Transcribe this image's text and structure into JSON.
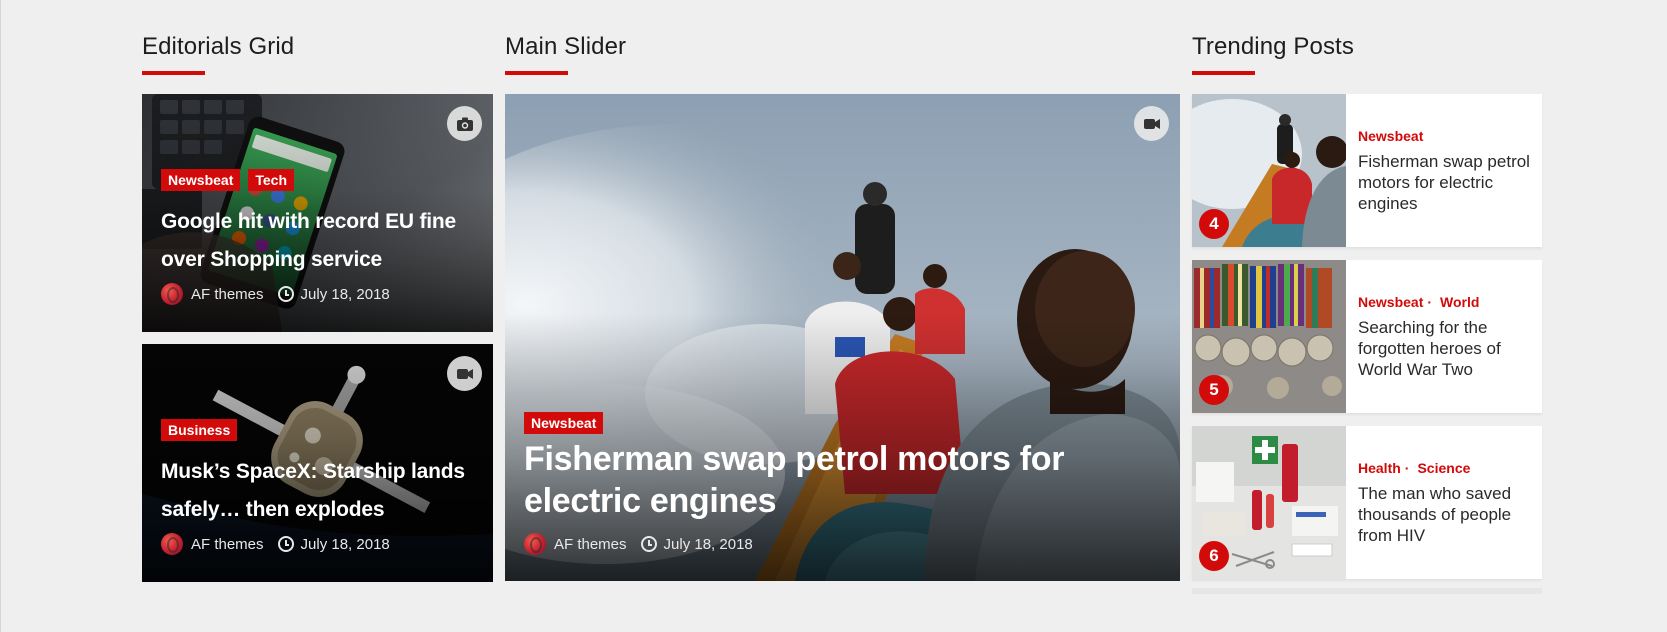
{
  "sections": {
    "editorials_title": "Editorials Grid",
    "slider_title": "Main Slider",
    "trending_title": "Trending Posts"
  },
  "colors": {
    "accent": "#d30a0a",
    "background": "#efefef"
  },
  "editorials": [
    {
      "categories": [
        "Newsbeat",
        "Tech"
      ],
      "title": "Google hit with record EU fine over Shopping service",
      "author": "AF themes",
      "date": "July 18, 2018",
      "media_icon": "camera-icon"
    },
    {
      "categories": [
        "Business"
      ],
      "title": "Musk’s SpaceX: Starship lands safely… then explodes",
      "author": "AF themes",
      "date": "July 18, 2018",
      "media_icon": "video-icon"
    }
  ],
  "slider": {
    "category": "Newsbeat",
    "title": "Fisherman swap petrol motors for electric engines",
    "author": "AF themes",
    "date": "July 18, 2018",
    "media_icon": "video-icon"
  },
  "trending": [
    {
      "rank": "4",
      "categories": [
        "Newsbeat"
      ],
      "title": "Fisherman swap petrol motors for electric engines"
    },
    {
      "rank": "5",
      "categories": [
        "Newsbeat",
        "World"
      ],
      "title": "Searching for the forgotten heroes of World War Two"
    },
    {
      "rank": "6",
      "categories": [
        "Health",
        "Science"
      ],
      "title": "The man who saved thousands of people from HIV"
    }
  ]
}
